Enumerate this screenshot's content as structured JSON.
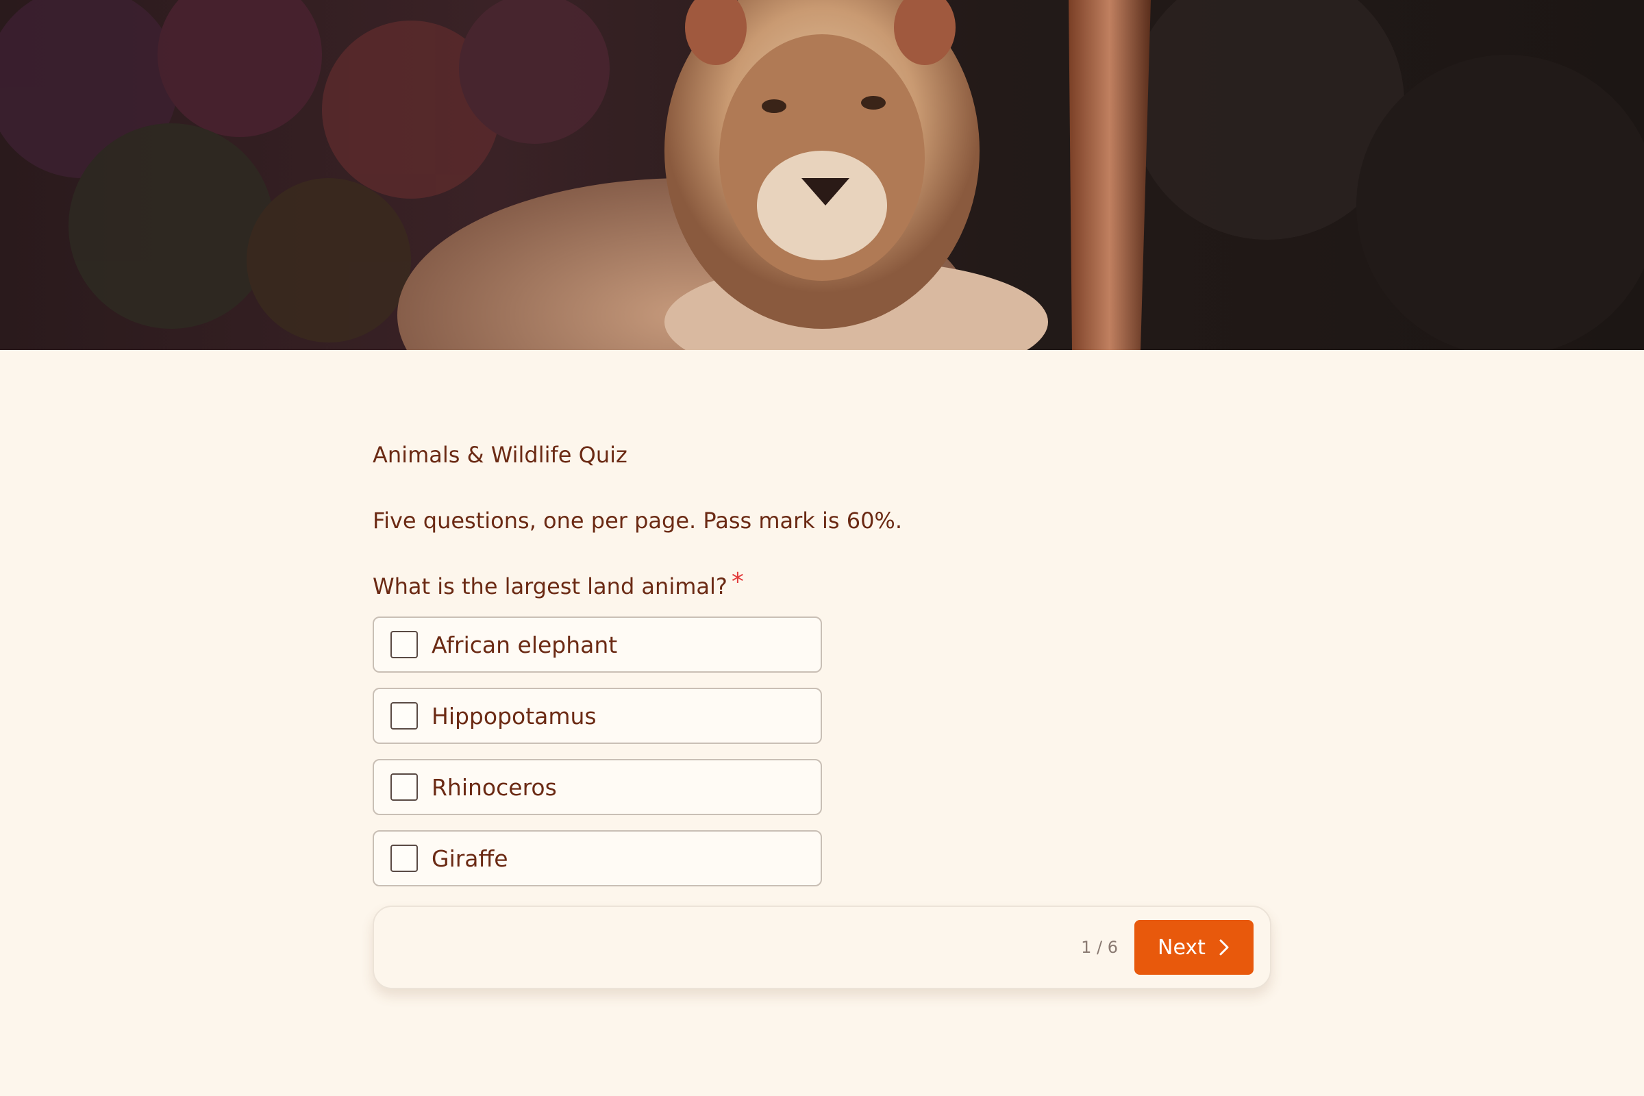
{
  "hero": {
    "image_description_icon": "lion-photo"
  },
  "form": {
    "title": "Animals & Wildlife Quiz",
    "description": "Five questions, one per page. Pass mark is 60%."
  },
  "question": {
    "label": "What is the largest land animal?",
    "required_mark": "*",
    "options": [
      {
        "label": "African elephant",
        "checked": false
      },
      {
        "label": "Hippopotamus",
        "checked": false
      },
      {
        "label": "Rhinoceros",
        "checked": false
      },
      {
        "label": "Giraffe",
        "checked": false
      }
    ]
  },
  "footer": {
    "page_counter": "1 / 6",
    "next_label": "Next",
    "next_icon": "chevron-right-icon"
  },
  "colors": {
    "background": "#fdf6ec",
    "text": "#6b2a14",
    "accent": "#e8590c",
    "required": "#e23b3b"
  }
}
